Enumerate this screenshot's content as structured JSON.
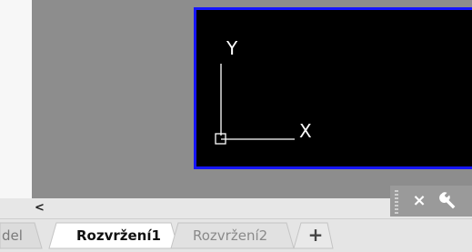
{
  "viewport": {
    "ucs_x_label": "X",
    "ucs_y_label": "Y",
    "background_color": "#000000",
    "border_color": "#1515ff"
  },
  "scrollbar": {
    "left_arrow": "<"
  },
  "tool_panel": {
    "close_glyph": "×",
    "wrench_icon": "wrench-icon"
  },
  "tabs": [
    {
      "label": "del",
      "active": false
    },
    {
      "label": "Rozvržení1",
      "active": true
    },
    {
      "label": "Rozvržení2",
      "active": false
    }
  ],
  "add_tab": "+"
}
